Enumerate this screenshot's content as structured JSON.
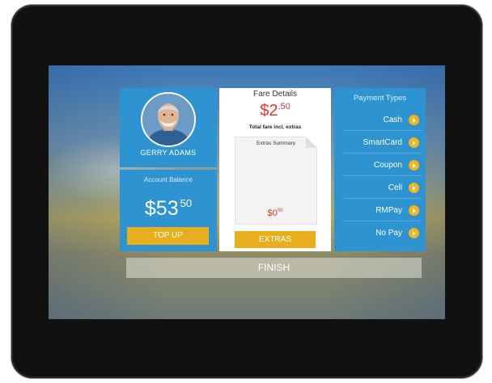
{
  "profile": {
    "name": "GERRY ADAMS",
    "avatar_icon": "user-photo"
  },
  "balance": {
    "label": "Account Balance",
    "amount_main": "$53",
    "amount_cents": "50",
    "topup_label": "TOP UP"
  },
  "fare": {
    "title": "Fare Details",
    "amount_main": "$2",
    "amount_cents": ".50",
    "subtitle": "Total fare incl. extras",
    "extras_title": "Extras Summary",
    "extras_main": "$0",
    "extras_cents": "00",
    "extras_button": "EXTRAS"
  },
  "payments": {
    "title": "Payment Types",
    "items": [
      {
        "label": "Cash"
      },
      {
        "label": "SmartCard"
      },
      {
        "label": "Coupon"
      },
      {
        "label": "Cell"
      },
      {
        "label": "RMPay"
      },
      {
        "label": "No Pay"
      }
    ]
  },
  "finish_label": "FINISH",
  "colors": {
    "panel_blue": "#2e93d1",
    "accent_yellow": "#e9ae1e",
    "price_red": "#e53530"
  }
}
